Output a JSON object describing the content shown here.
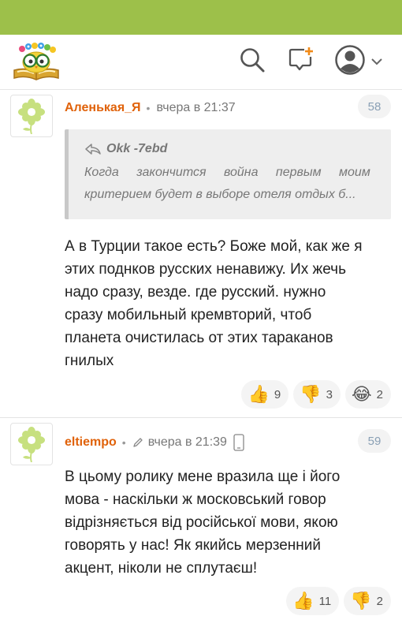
{
  "header": {
    "logo_icon": "owl-on-book-logo",
    "search_icon": "search-icon",
    "new_comment_icon": "comment-plus-icon",
    "profile_icon": "user-icon",
    "dropdown_icon": "chevron-down-icon"
  },
  "colors": {
    "topbar": "#9dc04a",
    "author": "#e0620a",
    "badge_text": "#8aa0b5"
  },
  "comments": [
    {
      "author": "Аленькая_Я",
      "time": "вчера в 21:37",
      "number": "58",
      "quote": {
        "author": "Okk -7ebd",
        "line1": "Когда закончится война первым моим",
        "line2": "критерием будет в выборе отеля отдых б..."
      },
      "lines": [
        "А в Турции такое есть? Боже мой, как же я",
        "этих поднков русских ненавижу. Их жечь",
        "надо сразу, везде. где русский. нужно",
        "сразу мобильный кремвторий, чтоб",
        "планета очистилась от этих тараканов",
        "гнилых"
      ],
      "reactions": {
        "like": "9",
        "dislike": "3",
        "laugh": "2"
      }
    },
    {
      "author": "eltiempo",
      "time": "вчера в 21:39",
      "number": "59",
      "lines": [
        "В цьому ролику мене вразила ще і його",
        "мова - наскільки ж московський говор",
        "відрізняється від російської мови, якою",
        "говорять у нас! Як якийсь мерзенний",
        "акцент, ніколи не сплутаєш!"
      ],
      "reactions": {
        "like": "11",
        "dislike": "2"
      }
    }
  ]
}
